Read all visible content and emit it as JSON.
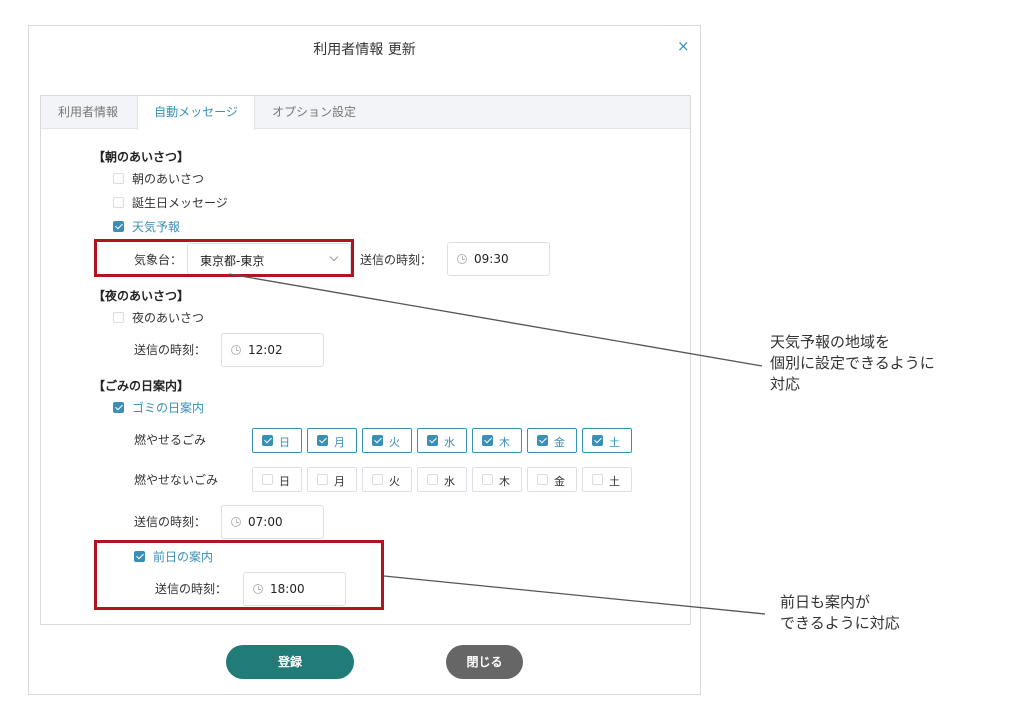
{
  "dialog": {
    "title": "利用者情報 更新",
    "close_label": "×"
  },
  "tabs": [
    {
      "label": "利用者情報",
      "active": false
    },
    {
      "label": "自動メッセージ",
      "active": true
    },
    {
      "label": "オプション設定",
      "active": false
    }
  ],
  "morning": {
    "section_title": "【朝のあいさつ】",
    "items": [
      {
        "label": "朝のあいさつ",
        "checked": false
      },
      {
        "label": "誕生日メッセージ",
        "checked": false
      },
      {
        "label": "天気予報",
        "checked": true
      }
    ],
    "station_label": "気象台：",
    "station_value": "東京都-東京",
    "send_time_label": "送信の時刻：",
    "send_time": "09:30"
  },
  "evening": {
    "section_title": "【夜のあいさつ】",
    "item": {
      "label": "夜のあいさつ",
      "checked": false
    },
    "send_time_label": "送信の時刻：",
    "send_time": "12:02"
  },
  "garbage": {
    "section_title": "【ごみの日案内】",
    "item": {
      "label": "ゴミの日案内",
      "checked": true
    },
    "burnable_label": "燃やせるごみ",
    "burnable_days": [
      {
        "label": "日",
        "checked": true
      },
      {
        "label": "月",
        "checked": true
      },
      {
        "label": "火",
        "checked": true
      },
      {
        "label": "水",
        "checked": true
      },
      {
        "label": "木",
        "checked": true
      },
      {
        "label": "金",
        "checked": true
      },
      {
        "label": "土",
        "checked": true
      }
    ],
    "nonburnable_label": "燃やせないごみ",
    "nonburnable_days": [
      {
        "label": "日",
        "checked": false
      },
      {
        "label": "月",
        "checked": false
      },
      {
        "label": "火",
        "checked": false
      },
      {
        "label": "水",
        "checked": false
      },
      {
        "label": "木",
        "checked": false
      },
      {
        "label": "金",
        "checked": false
      },
      {
        "label": "土",
        "checked": false
      }
    ],
    "send_time_label": "送信の時刻：",
    "send_time": "07:00",
    "prev_day": {
      "label": "前日の案内",
      "checked": true
    },
    "prev_send_time_label": "送信の時刻：",
    "prev_send_time": "18:00"
  },
  "footer": {
    "register_label": "登録",
    "close_label": "閉じる"
  },
  "annotations": {
    "weather_note": [
      "天気予報の地域を",
      "個別に設定できるように",
      "対応"
    ],
    "prev_day_note": [
      "前日も案内が",
      "できるように対応"
    ]
  },
  "colors": {
    "accent": "#3a8fb7",
    "primary_button": "#217c78",
    "secondary_button": "#666666",
    "highlight": "#b0141e"
  }
}
